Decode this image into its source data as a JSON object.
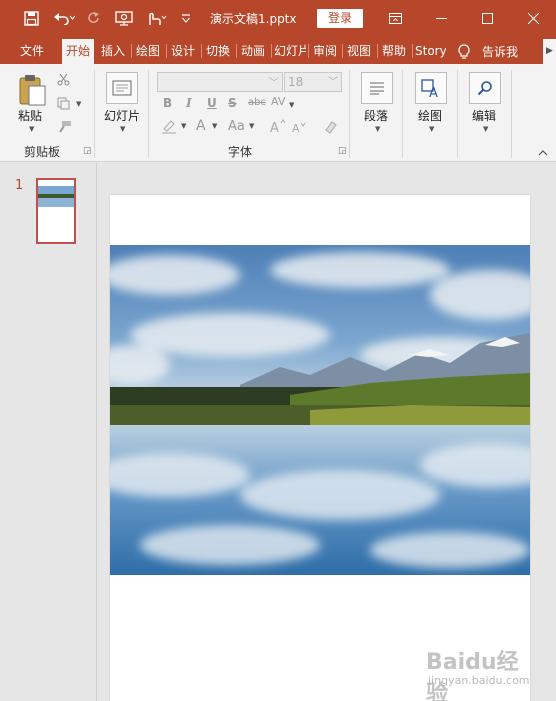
{
  "title_bar": {
    "document_title": "演示文稿1.pptx",
    "login_label": "登录",
    "icons": [
      "save-icon",
      "undo-icon",
      "redo-icon",
      "present-icon",
      "touch-mode-icon",
      "customize-qat-icon",
      "ribbon-display-icon",
      "minimize-icon",
      "maximize-icon",
      "close-icon"
    ]
  },
  "tabs": [
    "文件",
    "开始",
    "插入",
    "绘图",
    "设计",
    "切换",
    "动画",
    "幻灯片",
    "审阅",
    "视图",
    "帮助",
    "Storyline"
  ],
  "active_tab": "开始",
  "tell_me": "告诉我",
  "ribbon": {
    "clipboard": {
      "paste_label": "粘贴",
      "group_label": "剪贴板"
    },
    "slides": {
      "new_slide_label": "幻灯片"
    },
    "font": {
      "font_name": "",
      "font_size": "18",
      "group_label": "字体",
      "bold": "B",
      "italic": "I",
      "underline": "U",
      "strike": "S",
      "abc": "abc",
      "spacing": "AV",
      "font_color": "A",
      "case": "Aa"
    },
    "paragraph": {
      "label": "段落"
    },
    "drawing": {
      "label": "绘图"
    },
    "editing": {
      "label": "编辑"
    }
  },
  "thumbnails": [
    {
      "number": "1"
    }
  ],
  "watermark": {
    "logo": "Baidu经验",
    "url": "jingyan.baidu.com"
  },
  "colors": {
    "accent": "#b7472a",
    "ribbon_bg": "#f3f3f3",
    "workspace_bg": "#e6e6e6"
  }
}
